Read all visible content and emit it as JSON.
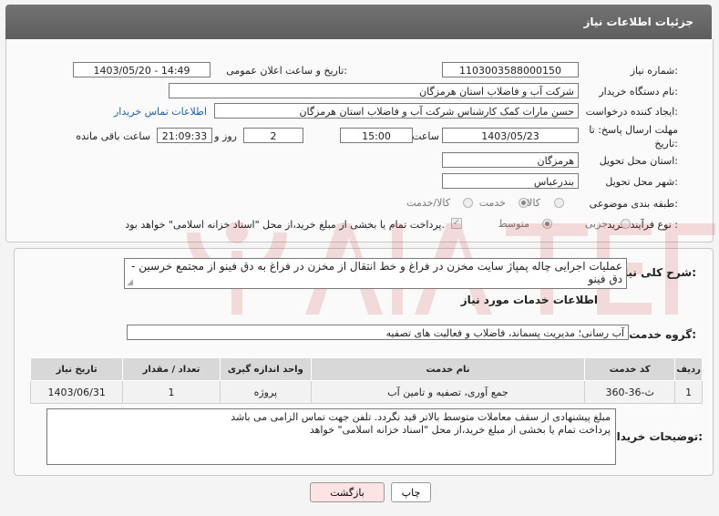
{
  "header": {
    "title": "جزئیات اطلاعات نیاز"
  },
  "need_number": {
    "label": "شماره نیاز:",
    "value": "1103003588000150"
  },
  "announce": {
    "label": "تاریخ و ساعت اعلان عمومی:",
    "value": "1403/05/20 - 14:49"
  },
  "buyer": {
    "label": "نام دستگاه خریدار:",
    "value": "شرکت آب و فاضلاب استان هرمزگان"
  },
  "creator": {
    "label": "ایجاد کننده درخواست:",
    "value": "حسن مارات کمک کارشناس شرکت آب و فاضلاب استان هرمزگان",
    "contact_link": "اطلاعات تماس خریدار"
  },
  "deadline": {
    "label_line1": "مهلت ارسال پاسخ: تا",
    "label_line2": "تاریخ:",
    "date": "1403/05/23",
    "time_label": "ساعت",
    "time": "15:00",
    "days": "2",
    "days_label": "روز و",
    "remaining": "21:09:33",
    "remaining_label": "ساعت باقی مانده"
  },
  "province": {
    "label": "استان محل تحویل:",
    "value": "هرمزگان"
  },
  "city": {
    "label": "شهر محل تحویل:",
    "value": "بندرعباس"
  },
  "category": {
    "label": "طبقه بندی موضوعی:",
    "options": [
      "کالا",
      "خدمت",
      "کالا/خدمت"
    ],
    "selected": "خدمت"
  },
  "purchase_type": {
    "label": "نوع فرآیند خرید :",
    "options": [
      "جزیی",
      "متوسط"
    ],
    "selected": "متوسط",
    "note": "پرداخت تمام یا بخشی از مبلغ خرید،از محل \"اسناد خزانه اسلامی\" خواهد بود."
  },
  "description": {
    "label": "شرح کلی نیاز:",
    "value": "عملیات اجرایی چاله پمپاژ سایت مخزن در فراغ و خط انتقال از مخزن در فراغ به دق فینو از مجتمع خرسین - دق فینو"
  },
  "services_title": "اطلاعات خدمات مورد نیاز",
  "service_group": {
    "label": "گروه خدمت:",
    "value": "آب رسانی؛ مدیریت پسماند، فاضلاب و فعالیت های تصفیه"
  },
  "table": {
    "headers": [
      "ردیف",
      "کد خدمت",
      "نام خدمت",
      "واحد اندازه گیری",
      "تعداد / مقدار",
      "تاریخ نیاز"
    ],
    "rows": [
      [
        "1",
        "ث-36-360",
        "جمع آوری، تصفیه و تامین آب",
        "پروژه",
        "1",
        "1403/06/31"
      ]
    ]
  },
  "buyer_notes": {
    "label": "توضیحات خریدار:",
    "line1": "مبلغ پیشنهادی از سقف معاملات متوسط بالاتر قید نگردد. تلفن جهت تماس الزامی می باشد",
    "line2": "پرداخت تمام یا بخشی از مبلغ خرید،از محل \"اسناد خزانه اسلامی\" خواهد"
  },
  "buttons": {
    "print": "چاپ",
    "back": "بازگشت"
  },
  "colors": {
    "header": "#666666",
    "link": "#1c5fb5",
    "back_button": "#fde3e3"
  }
}
